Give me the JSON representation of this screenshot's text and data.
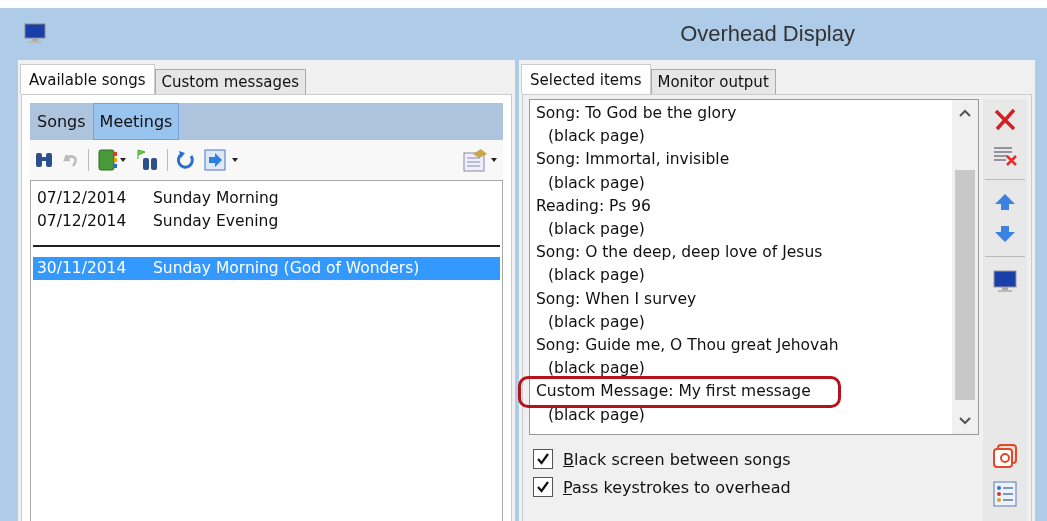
{
  "window": {
    "title": "Overhead Display"
  },
  "left_tabs": [
    {
      "label": "Available songs",
      "selected": true
    },
    {
      "label": "Custom messages",
      "selected": false
    }
  ],
  "sub_tabs": [
    {
      "label": "Songs",
      "selected": false
    },
    {
      "label": "Meetings",
      "selected": true
    }
  ],
  "meeting_groups": [
    [
      {
        "date": "07/12/2014",
        "name": "Sunday Morning",
        "selected": false
      },
      {
        "date": "07/12/2014",
        "name": "Sunday Evening",
        "selected": false
      }
    ],
    [
      {
        "date": "30/11/2014",
        "name": "Sunday Morning (God of Wonders)",
        "selected": true
      }
    ]
  ],
  "right_tabs": [
    {
      "label": "Selected items",
      "selected": true
    },
    {
      "label": "Monitor output",
      "selected": false
    }
  ],
  "selected_items": [
    {
      "title": "Song: To God be the glory",
      "detail": "(black page)",
      "highlighted": false
    },
    {
      "title": "Song: Immortal, invisible",
      "detail": "(black page)",
      "highlighted": false
    },
    {
      "title": "Reading: Ps 96",
      "detail": "(black page)",
      "highlighted": false
    },
    {
      "title": "Song: O the deep, deep love of Jesus",
      "detail": "(black page)",
      "highlighted": false
    },
    {
      "title": "Song: When I survey",
      "detail": "(black page)",
      "highlighted": false
    },
    {
      "title": "Song: Guide me, O Thou great Jehovah",
      "detail": "(black page)",
      "highlighted": false
    },
    {
      "title": "Custom Message: My first message",
      "detail": "(black page)",
      "highlighted": true
    }
  ],
  "options": [
    {
      "label": "Black screen between songs",
      "checked": true
    },
    {
      "label": "Pass keystrokes to overhead",
      "checked": true
    }
  ]
}
